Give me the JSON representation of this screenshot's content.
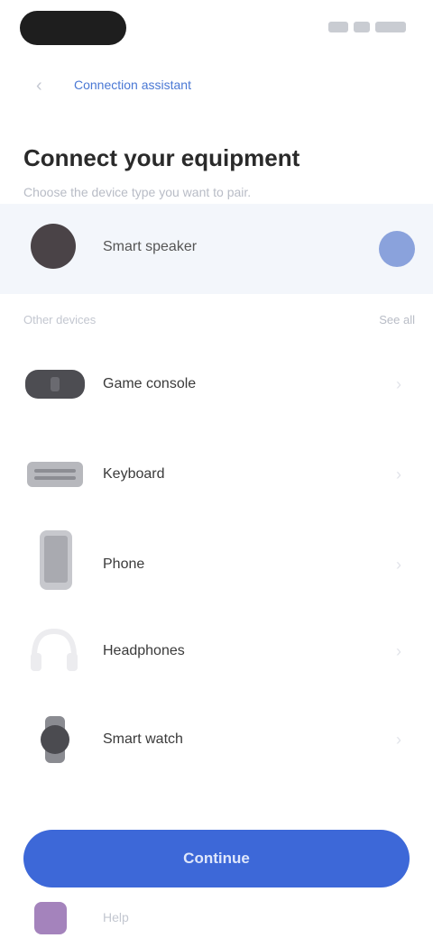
{
  "status_bar": {
    "time_pill": "",
    "icons": [
      "signal-icon",
      "wifi-icon",
      "battery-icon"
    ]
  },
  "nav": {
    "back_icon": "arrow-left-icon",
    "link_label": "Connection assistant"
  },
  "header": {
    "title": "Connect your equipment",
    "subtitle": "Choose the device type you want to pair."
  },
  "highlight_card": {
    "label": "Smart speaker",
    "icon": "speaker-icon",
    "toggle_icon": "radio-selected-icon"
  },
  "section": {
    "left": "Other devices",
    "right": "See all"
  },
  "devices": [
    {
      "label": "Game console",
      "icon": "gamepad-icon"
    },
    {
      "label": "Keyboard",
      "icon": "keyboard-icon"
    },
    {
      "label": "Phone",
      "icon": "phone-icon"
    },
    {
      "label": "Headphones",
      "icon": "headphones-icon"
    },
    {
      "label": "Smart watch",
      "icon": "watch-icon"
    }
  ],
  "primary_button": {
    "label": "Continue"
  },
  "footer": {
    "label": "Help",
    "icon": "help-icon"
  },
  "colors": {
    "accent": "#3d68d8",
    "link": "#4a78d4",
    "card_bg": "#f3f6fb"
  }
}
